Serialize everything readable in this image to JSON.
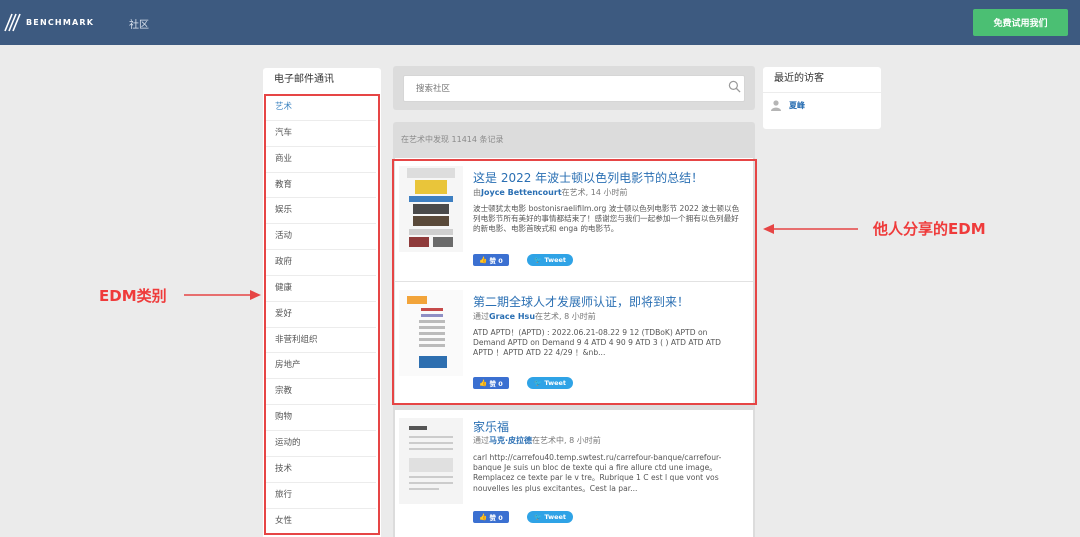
{
  "header": {
    "logo_text": "BENCHMARK",
    "nav_community": "社区",
    "trial_button": "免费试用我们"
  },
  "sidebar": {
    "title": "电子邮件通讯",
    "categories": [
      "艺术",
      "汽车",
      "商业",
      "教育",
      "娱乐",
      "活动",
      "政府",
      "健康",
      "爱好",
      "非营利组织",
      "房地产",
      "宗教",
      "购物",
      "运动的",
      "技术",
      "旅行",
      "女性"
    ],
    "active_index": 0
  },
  "search": {
    "placeholder": "搜索社区"
  },
  "results": {
    "count_text": "在艺术中发现 11414 条记录",
    "items": [
      {
        "title": "这是 2022 年波士顿以色列电影节的总结！",
        "meta_prefix": "由",
        "author": "Joyce Bettencourt",
        "meta_suffix": "在艺术, 14 小时前",
        "excerpt": "波士顿犹太电影 bostonisraelifilm.org 波士顿以色列电影节 2022 波士顿以色列电影节所有美好的事情都结束了！感谢您与我们一起参加一个拥有以色列最好的新电影、电影首映式和 enga 的电影节。",
        "like_label": "赞 0",
        "tweet_label": "Tweet"
      },
      {
        "title": "第二期全球人才发展师认证，即将到来！",
        "meta_prefix": "通过",
        "author": "Grace Hsu",
        "meta_suffix": "在艺术, 8 小时前",
        "excerpt": "ATD APTD！(APTD) : 2022.06.21-08.22 9 12 (TDBoK) APTD on Demand APTD on Demand 9 4 ATD 4 90 9 ATD 3 ( ) ATD ATD ATD APTD ！APTD ATD 22 4/29 ！&nb...",
        "like_label": "赞 0",
        "tweet_label": "Tweet"
      },
      {
        "title": "家乐福",
        "meta_prefix": "通过",
        "author": "马克·皮拉德",
        "meta_suffix": "在艺术中, 8 小时前",
        "excerpt": "carl http://carrefou40.temp.swtest.ru/carrefour-banque/carrefour-banque Je suis un bloc de texte qui a fire allure ctd une image。Remplacez ce texte par le v tre。Rubrique 1 C est l que vont vos nouvelles les plus excitantes。Cest la par...",
        "like_label": "赞 0",
        "tweet_label": "Tweet"
      }
    ]
  },
  "visitors": {
    "title": "最近的访客",
    "names": [
      "夏峰"
    ]
  },
  "annotations": {
    "left_label": "EDM类别",
    "right_label": "他人分享的EDM"
  },
  "colors": {
    "header_bg": "#3d5a80",
    "trial_button": "#4bbf73",
    "link": "#2a6fb3",
    "annotation_red": "#e64545"
  }
}
